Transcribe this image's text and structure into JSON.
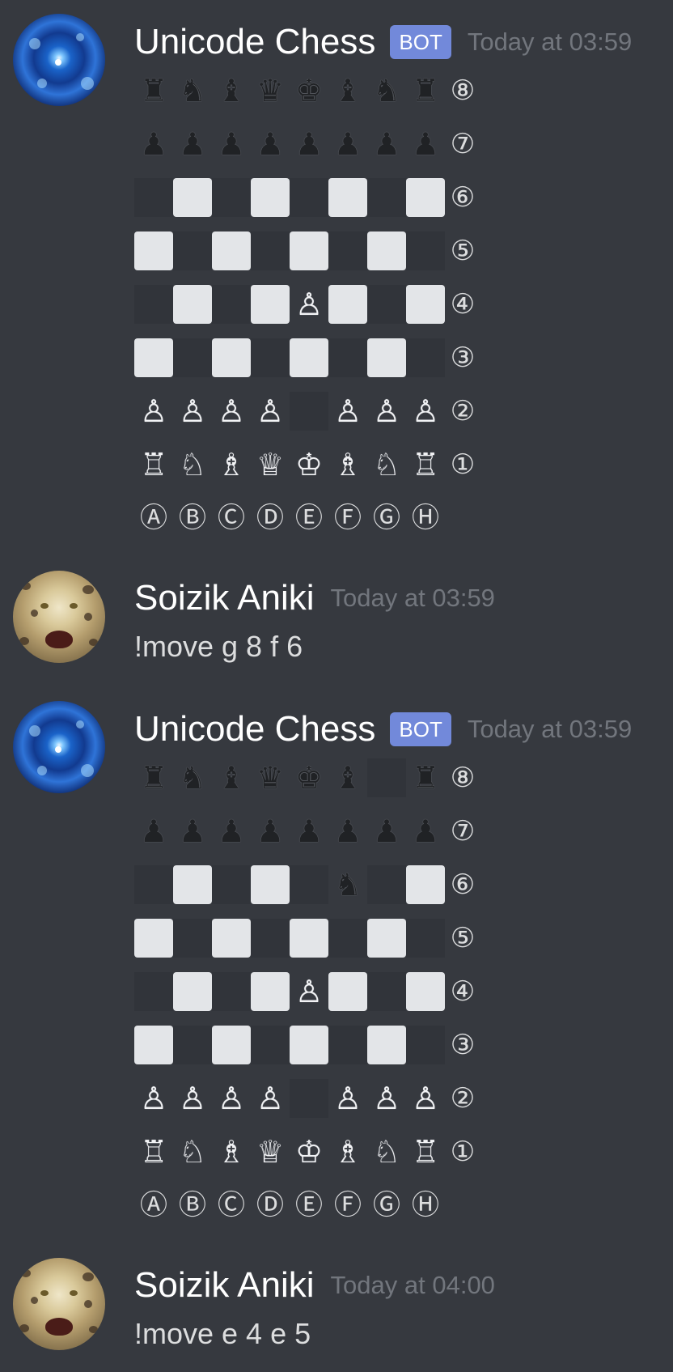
{
  "colors": {
    "background": "#36393f",
    "bot_tag": "#7289da",
    "light_square": "#e3e5e8",
    "timestamp": "#72767d"
  },
  "messages": [
    {
      "type": "board",
      "avatar": "galaxy-avatar",
      "username": "Unicode Chess",
      "tag": "BOT",
      "timestamp": "Today at 03:59",
      "board": {
        "ranks": [
          [
            "♜",
            "♞",
            "♝",
            "♛",
            "♚",
            "♝",
            "♞",
            "♜"
          ],
          [
            "♟",
            "♟",
            "♟",
            "♟",
            "♟",
            "♟",
            "♟",
            "♟"
          ],
          [
            "",
            "",
            "",
            "",
            "",
            "",
            "",
            ""
          ],
          [
            "",
            "",
            "",
            "",
            "",
            "",
            "",
            ""
          ],
          [
            "",
            "",
            "",
            "",
            "♙",
            "",
            "",
            ""
          ],
          [
            "",
            "",
            "",
            "",
            "",
            "",
            "",
            ""
          ],
          [
            "♙",
            "♙",
            "♙",
            "♙",
            "",
            "♙",
            "♙",
            "♙"
          ],
          [
            "♖",
            "♘",
            "♗",
            "♕",
            "♔",
            "♗",
            "♘",
            "♖"
          ]
        ],
        "rank_labels": [
          "⑧",
          "⑦",
          "⑥",
          "⑤",
          "④",
          "③",
          "②",
          "①"
        ],
        "file_labels": [
          "Ⓐ",
          "Ⓑ",
          "Ⓒ",
          "Ⓓ",
          "Ⓔ",
          "Ⓕ",
          "Ⓖ",
          "Ⓗ"
        ]
      }
    },
    {
      "type": "text",
      "avatar": "leopard-avatar",
      "username": "Soizik Aniki",
      "timestamp": "Today at 03:59",
      "text": "!move g 8 f 6"
    },
    {
      "type": "board",
      "avatar": "galaxy-avatar",
      "username": "Unicode Chess",
      "tag": "BOT",
      "timestamp": "Today at 03:59",
      "board": {
        "ranks": [
          [
            "♜",
            "♞",
            "♝",
            "♛",
            "♚",
            "♝",
            "",
            "♜"
          ],
          [
            "♟",
            "♟",
            "♟",
            "♟",
            "♟",
            "♟",
            "♟",
            "♟"
          ],
          [
            "",
            "",
            "",
            "",
            "",
            "♞",
            "",
            ""
          ],
          [
            "",
            "",
            "",
            "",
            "",
            "",
            "",
            ""
          ],
          [
            "",
            "",
            "",
            "",
            "♙",
            "",
            "",
            ""
          ],
          [
            "",
            "",
            "",
            "",
            "",
            "",
            "",
            ""
          ],
          [
            "♙",
            "♙",
            "♙",
            "♙",
            "",
            "♙",
            "♙",
            "♙"
          ],
          [
            "♖",
            "♘",
            "♗",
            "♕",
            "♔",
            "♗",
            "♘",
            "♖"
          ]
        ],
        "rank_labels": [
          "⑧",
          "⑦",
          "⑥",
          "⑤",
          "④",
          "③",
          "②",
          "①"
        ],
        "file_labels": [
          "Ⓐ",
          "Ⓑ",
          "Ⓒ",
          "Ⓓ",
          "Ⓔ",
          "Ⓕ",
          "Ⓖ",
          "Ⓗ"
        ]
      }
    },
    {
      "type": "text",
      "avatar": "leopard-avatar",
      "username": "Soizik Aniki",
      "timestamp": "Today at 04:00",
      "text": "!move e 4 e 5"
    }
  ]
}
